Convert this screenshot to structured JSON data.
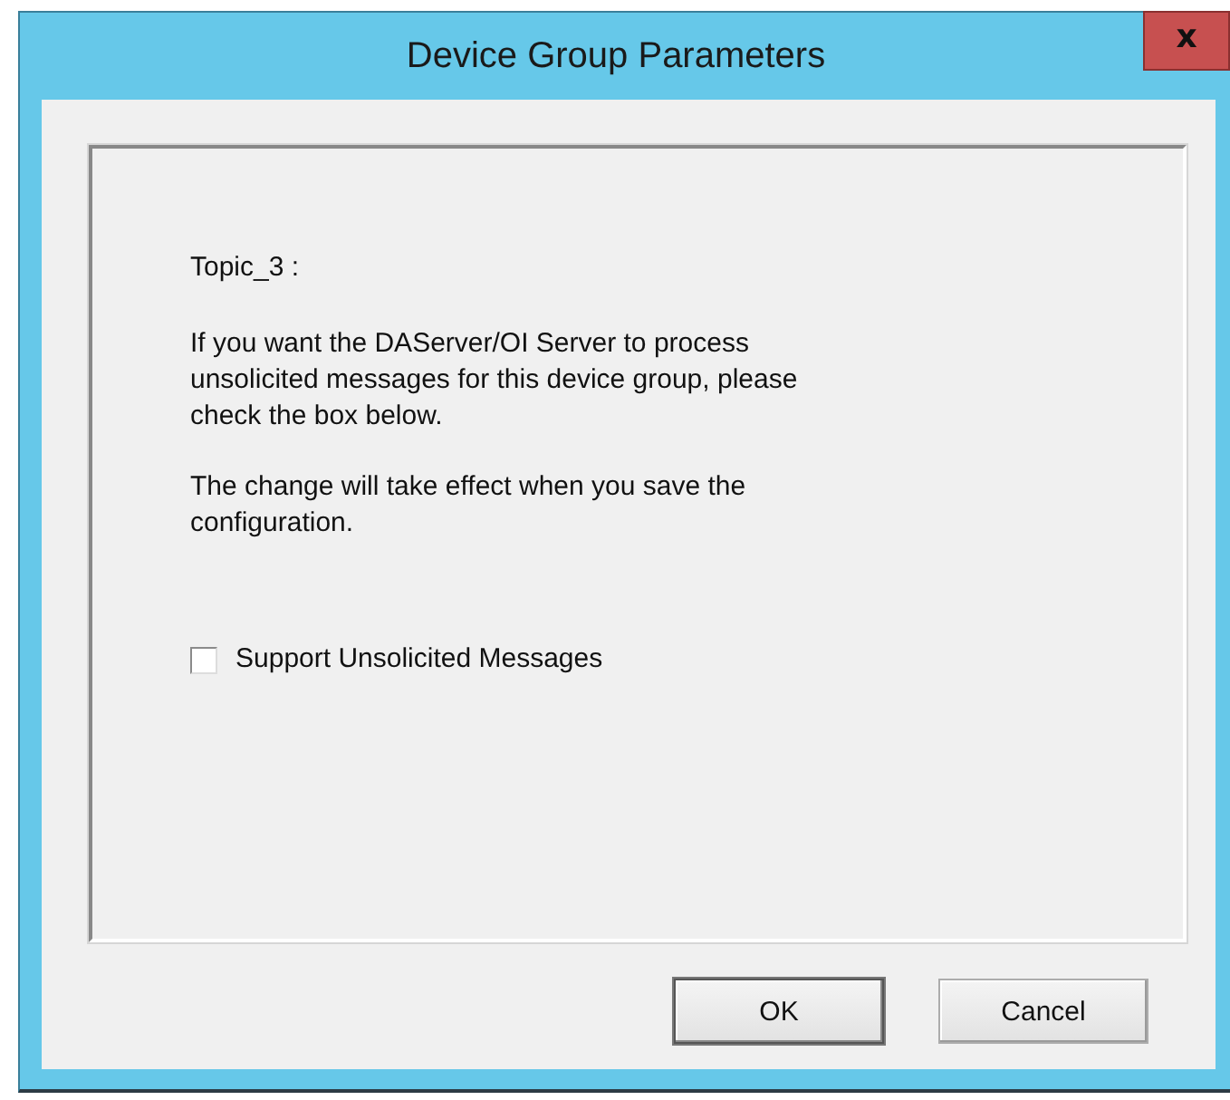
{
  "window": {
    "title": "Device Group Parameters",
    "close": "x"
  },
  "topic": "Topic_3 :",
  "paragraphs": [
    "If you want the DAServer/OI Server to process unsolicited messages for this device group, please check the box below.",
    "The change will take effect when you save the configuration."
  ],
  "checkbox": {
    "label": "Support Unsolicited Messages",
    "checked": false
  },
  "buttons": [
    {
      "label": "OK",
      "default": true
    },
    {
      "label": "Cancel",
      "default": false
    }
  ]
}
